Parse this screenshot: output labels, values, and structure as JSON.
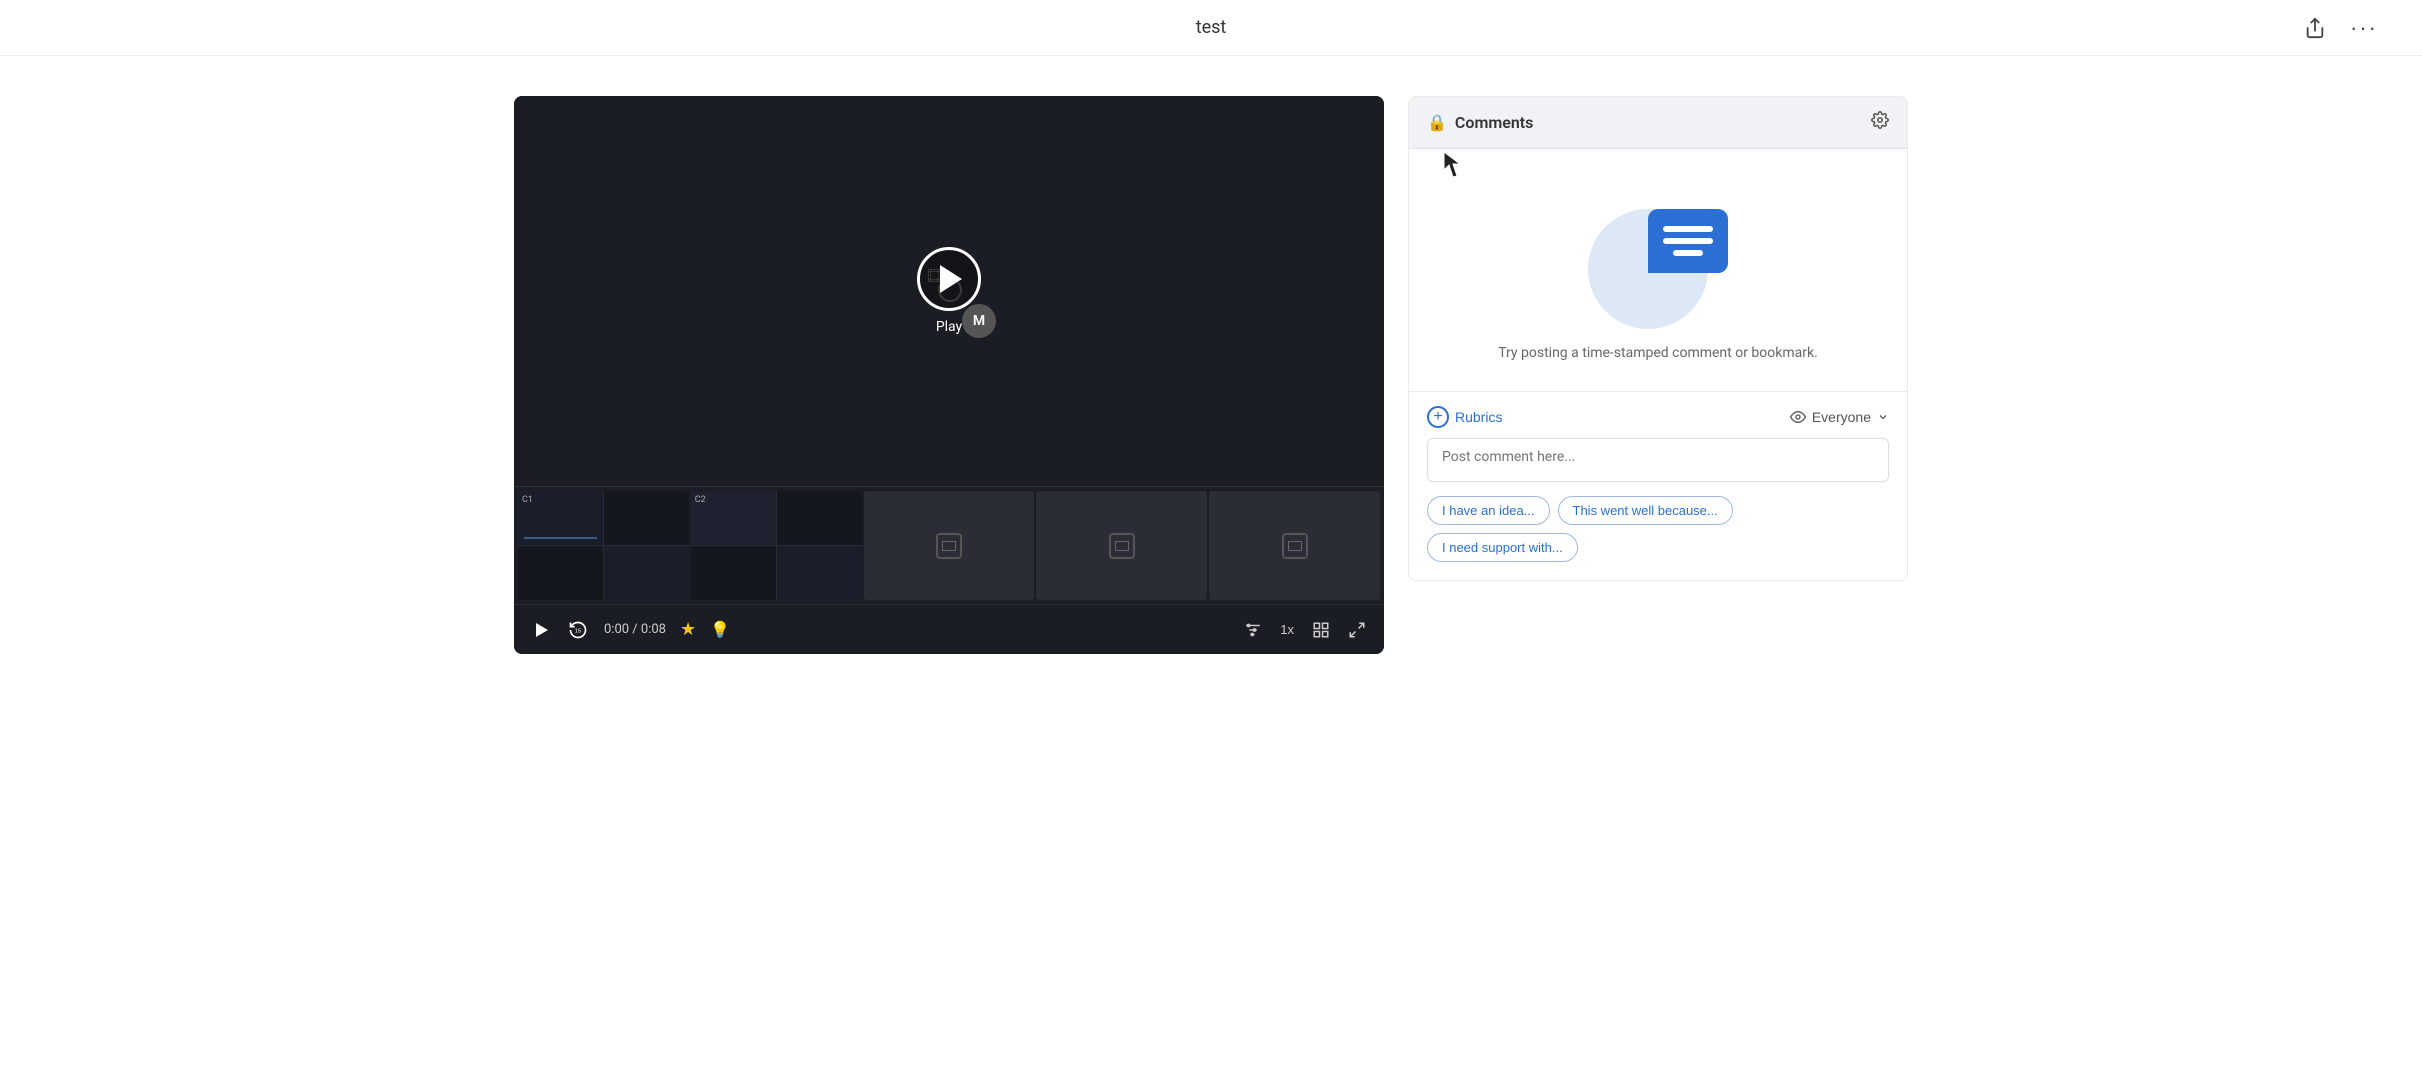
{
  "header": {
    "title": "test",
    "share_label": "share",
    "more_label": "more"
  },
  "video": {
    "time_current": "0:00",
    "time_total": "0:08",
    "time_display": "0:00 / 0:08",
    "speed": "1x",
    "play_label": "Play",
    "avatar_label": "M",
    "screen_labels": [
      "C1",
      "C2"
    ]
  },
  "comments": {
    "title": "Comments",
    "empty_text": "Try posting a time-stamped comment or bookmark.",
    "placeholder": "Post comment here...",
    "rubrics_label": "Rubrics",
    "visibility_label": "Everyone",
    "quick_prompts": [
      "I have an idea...",
      "This went well because...",
      "I need support with..."
    ],
    "settings_label": "settings"
  }
}
